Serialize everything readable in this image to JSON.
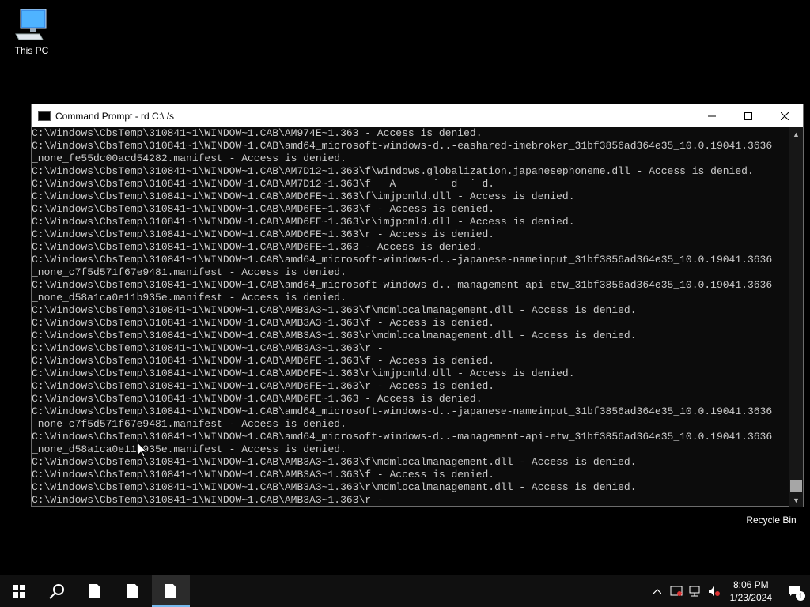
{
  "desktop": {
    "icons": [
      {
        "label": "This PC",
        "icon": "computer-icon"
      },
      {
        "label": "Recycle Bin",
        "icon": "recycle-bin-icon"
      }
    ]
  },
  "window": {
    "title": "Command Prompt - rd  C:\\ /s",
    "controls": {
      "minimize": "minimize-icon",
      "maximize": "maximize-icon",
      "close": "close-icon"
    }
  },
  "console": {
    "lines": [
      "C:\\Windows\\CbsTemp\\310841~1\\WINDOW~1.CAB\\AM974E~1.363 - Access is denied.",
      "C:\\Windows\\CbsTemp\\310841~1\\WINDOW~1.CAB\\amd64_microsoft-windows-d..-eashared-imebroker_31bf3856ad364e35_10.0.19041.3636",
      "_none_fe55dc00acd54282.manifest - Access is denied.",
      "C:\\Windows\\CbsTemp\\310841~1\\WINDOW~1.CAB\\AM7D12~1.363\\f\\windows.globalization.japanesephoneme.dll - Access is denied.",
      "C:\\Windows\\CbsTemp\\310841~1\\WINDOW~1.CAB\\AM7D12~1.363\\f   A      ˙  d  ˙ d.",
      "C:\\Windows\\CbsTemp\\310841~1\\WINDOW~1.CAB\\AMD6FE~1.363\\f\\imjpcmld.dll - Access is denied.",
      "C:\\Windows\\CbsTemp\\310841~1\\WINDOW~1.CAB\\AMD6FE~1.363\\f - Access is denied.",
      "C:\\Windows\\CbsTemp\\310841~1\\WINDOW~1.CAB\\AMD6FE~1.363\\r\\imjpcmld.dll - Access is denied.",
      "C:\\Windows\\CbsTemp\\310841~1\\WINDOW~1.CAB\\AMD6FE~1.363\\r - Access is denied.",
      "C:\\Windows\\CbsTemp\\310841~1\\WINDOW~1.CAB\\AMD6FE~1.363 - Access is denied.",
      "C:\\Windows\\CbsTemp\\310841~1\\WINDOW~1.CAB\\amd64_microsoft-windows-d..-japanese-nameinput_31bf3856ad364e35_10.0.19041.3636",
      "_none_c7f5d571f67e9481.manifest - Access is denied.",
      "C:\\Windows\\CbsTemp\\310841~1\\WINDOW~1.CAB\\amd64_microsoft-windows-d..-management-api-etw_31bf3856ad364e35_10.0.19041.3636",
      "_none_d58a1ca0e11b935e.manifest - Access is denied.",
      "C:\\Windows\\CbsTemp\\310841~1\\WINDOW~1.CAB\\AMB3A3~1.363\\f\\mdmlocalmanagement.dll - Access is denied.",
      "C:\\Windows\\CbsTemp\\310841~1\\WINDOW~1.CAB\\AMB3A3~1.363\\f - Access is denied.",
      "C:\\Windows\\CbsTemp\\310841~1\\WINDOW~1.CAB\\AMB3A3~1.363\\r\\mdmlocalmanagement.dll - Access is denied.",
      "C:\\Windows\\CbsTemp\\310841~1\\WINDOW~1.CAB\\AMB3A3~1.363\\r -",
      "C:\\Windows\\CbsTemp\\310841~1\\WINDOW~1.CAB\\AMD6FE~1.363\\f - Access is denied.",
      "C:\\Windows\\CbsTemp\\310841~1\\WINDOW~1.CAB\\AMD6FE~1.363\\r\\imjpcmld.dll - Access is denied.",
      "C:\\Windows\\CbsTemp\\310841~1\\WINDOW~1.CAB\\AMD6FE~1.363\\r - Access is denied.",
      "C:\\Windows\\CbsTemp\\310841~1\\WINDOW~1.CAB\\AMD6FE~1.363 - Access is denied.",
      "C:\\Windows\\CbsTemp\\310841~1\\WINDOW~1.CAB\\amd64_microsoft-windows-d..-japanese-nameinput_31bf3856ad364e35_10.0.19041.3636",
      "_none_c7f5d571f67e9481.manifest - Access is denied.",
      "C:\\Windows\\CbsTemp\\310841~1\\WINDOW~1.CAB\\amd64_microsoft-windows-d..-management-api-etw_31bf3856ad364e35_10.0.19041.3636",
      "_none_d58a1ca0e11b935e.manifest - Access is denied.",
      "C:\\Windows\\CbsTemp\\310841~1\\WINDOW~1.CAB\\AMB3A3~1.363\\f\\mdmlocalmanagement.dll - Access is denied.",
      "C:\\Windows\\CbsTemp\\310841~1\\WINDOW~1.CAB\\AMB3A3~1.363\\f - Access is denied.",
      "C:\\Windows\\CbsTemp\\310841~1\\WINDOW~1.CAB\\AMB3A3~1.363\\r\\mdmlocalmanagement.dll - Access is denied.",
      "C:\\Windows\\CbsTemp\\310841~1\\WINDOW~1.CAB\\AMB3A3~1.363\\r -"
    ]
  },
  "taskbar": {
    "buttons": [
      "start-icon",
      "search-icon",
      "file-icon",
      "file-icon",
      "file-icon"
    ],
    "tray": {
      "time": "8:06 PM",
      "date": "1/23/2024",
      "notification_count": "1"
    }
  }
}
